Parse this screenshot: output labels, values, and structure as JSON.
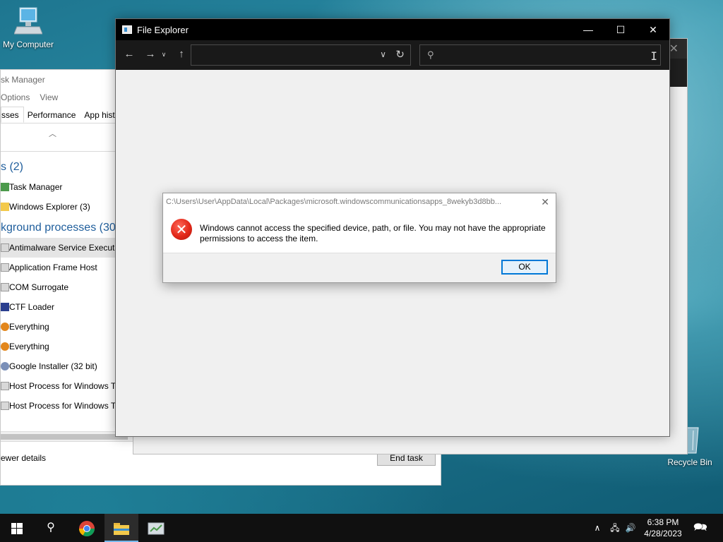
{
  "desktop": {
    "my_computer_label": "My Computer",
    "recycle_bin_label": "Recycle Bin"
  },
  "task_manager": {
    "title": "sk Manager",
    "menu": [
      "Options",
      "View"
    ],
    "tabs": [
      "sses",
      "Performance",
      "App histo"
    ],
    "apps_group": "s (2)",
    "apps": [
      "Task Manager",
      "Windows Explorer (3)"
    ],
    "bg_group": "kground processes (30)",
    "processes": [
      "Antimalware Service Executa",
      "Application Frame Host",
      "COM Surrogate",
      "CTF Loader",
      "Everything",
      "Everything",
      "Google Installer (32 bit)",
      "Host Process for Windows Ta",
      "Host Process for Windows Ta"
    ],
    "fewer_details": "ewer details",
    "end_task": "End task"
  },
  "file_explorer": {
    "title": "File Explorer",
    "address_value": "",
    "search_value": ""
  },
  "dialog": {
    "title": "C:\\Users\\User\\AppData\\Local\\Packages\\microsoft.windowscommunicationsapps_8wekyb3d8bb...",
    "message": "Windows cannot access the specified device, path, or file. You may not have the appropriate permissions to access the item.",
    "ok_label": "OK"
  },
  "taskbar": {
    "time": "6:38 PM",
    "date": "4/28/2023"
  },
  "colors": {
    "accent": "#0078d7",
    "error_red": "#e22718",
    "group_blue": "#1f5e9c"
  }
}
